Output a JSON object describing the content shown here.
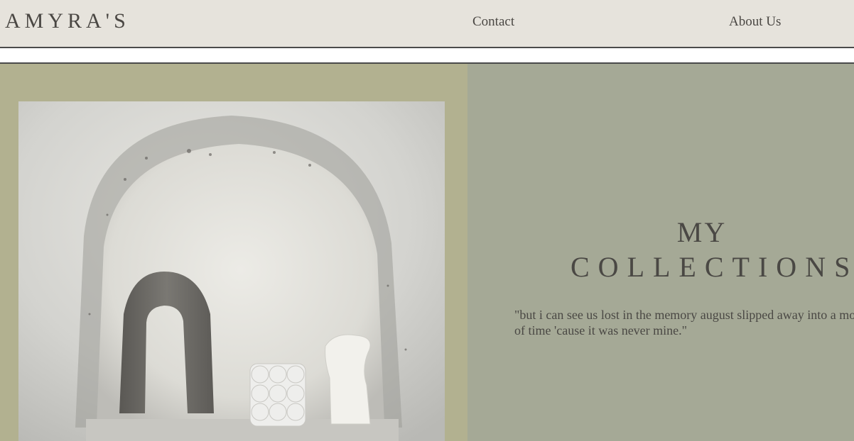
{
  "header": {
    "logo": "AMYRA'S",
    "nav": {
      "contact_label": "Contact",
      "about_label": "About Us"
    }
  },
  "hero": {
    "image_alt": "Ceramic sculptures in a plaster arch niche",
    "title_line1": "MY",
    "title_line2": "COLLECTIONS",
    "quote": "\"but i can see us lost in the memory august slipped away into a moment of time 'cause it was never mine.\""
  },
  "colors": {
    "nav_bg": "#e6e3dc",
    "left_panel": "#b2b190",
    "right_panel": "#a5a996",
    "text": "#4a4844"
  }
}
